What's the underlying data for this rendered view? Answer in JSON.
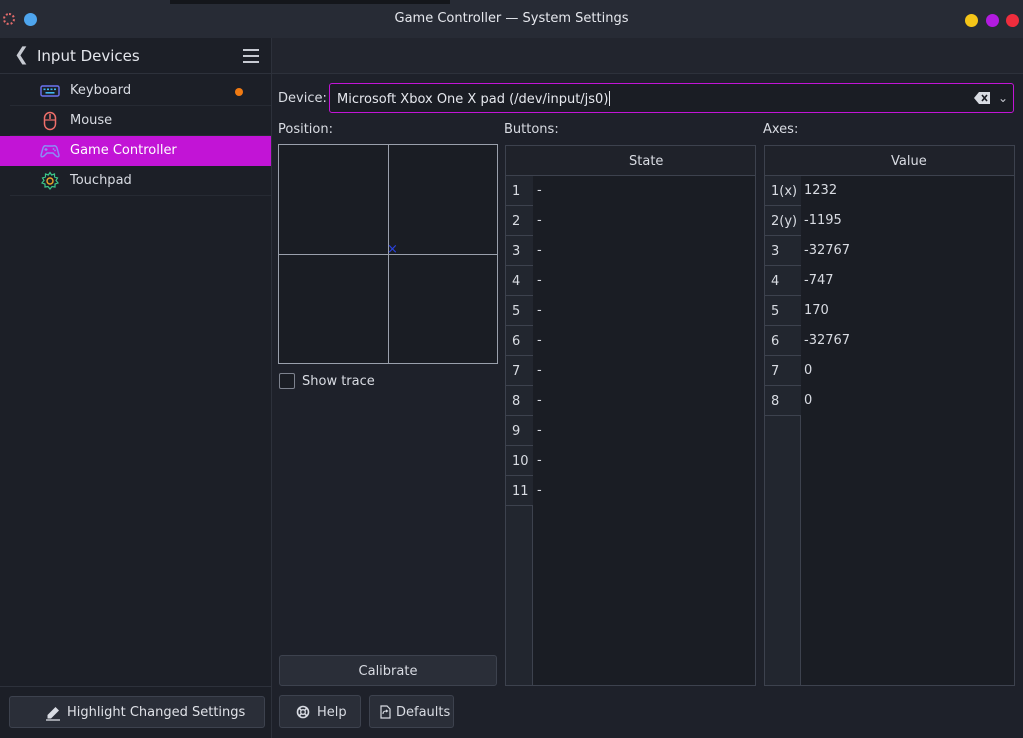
{
  "window": {
    "title": "Game Controller — System Settings"
  },
  "sidebar": {
    "title": "Input Devices",
    "items": [
      {
        "label": "Keyboard",
        "icon": "keyboard-icon",
        "modified": true
      },
      {
        "label": "Mouse",
        "icon": "mouse-icon"
      },
      {
        "label": "Game Controller",
        "icon": "gamepad-icon",
        "active": true
      },
      {
        "label": "Touchpad",
        "icon": "touchpad-icon"
      }
    ],
    "highlight_button": "Highlight Changed Settings"
  },
  "device": {
    "label": "Device:",
    "value": "Microsoft Xbox One X pad (/dev/input/js0)"
  },
  "position": {
    "label": "Position:",
    "show_trace_label": "Show trace",
    "show_trace_checked": false
  },
  "calibrate_label": "Calibrate",
  "buttons": {
    "label": "Buttons:",
    "column_header": "State",
    "rows": [
      {
        "num": "1",
        "state": "-"
      },
      {
        "num": "2",
        "state": "-"
      },
      {
        "num": "3",
        "state": "-"
      },
      {
        "num": "4",
        "state": "-"
      },
      {
        "num": "5",
        "state": "-"
      },
      {
        "num": "6",
        "state": "-"
      },
      {
        "num": "7",
        "state": "-"
      },
      {
        "num": "8",
        "state": "-"
      },
      {
        "num": "9",
        "state": "-"
      },
      {
        "num": "10",
        "state": "-"
      },
      {
        "num": "11",
        "state": "-"
      }
    ]
  },
  "axes": {
    "label": "Axes:",
    "column_header": "Value",
    "rows": [
      {
        "num": "1(x)",
        "value": "1232"
      },
      {
        "num": "2(y)",
        "value": "-1195"
      },
      {
        "num": "3",
        "value": "-32767"
      },
      {
        "num": "4",
        "value": "-747"
      },
      {
        "num": "5",
        "value": "170"
      },
      {
        "num": "6",
        "value": "-32767"
      },
      {
        "num": "7",
        "value": "0"
      },
      {
        "num": "8",
        "value": "0"
      }
    ]
  },
  "footer": {
    "help_label": "Help",
    "defaults_label": "Defaults"
  },
  "colors": {
    "accent": "#c214d6",
    "modified_dot": "#f07a12",
    "background": "#1e212a"
  }
}
